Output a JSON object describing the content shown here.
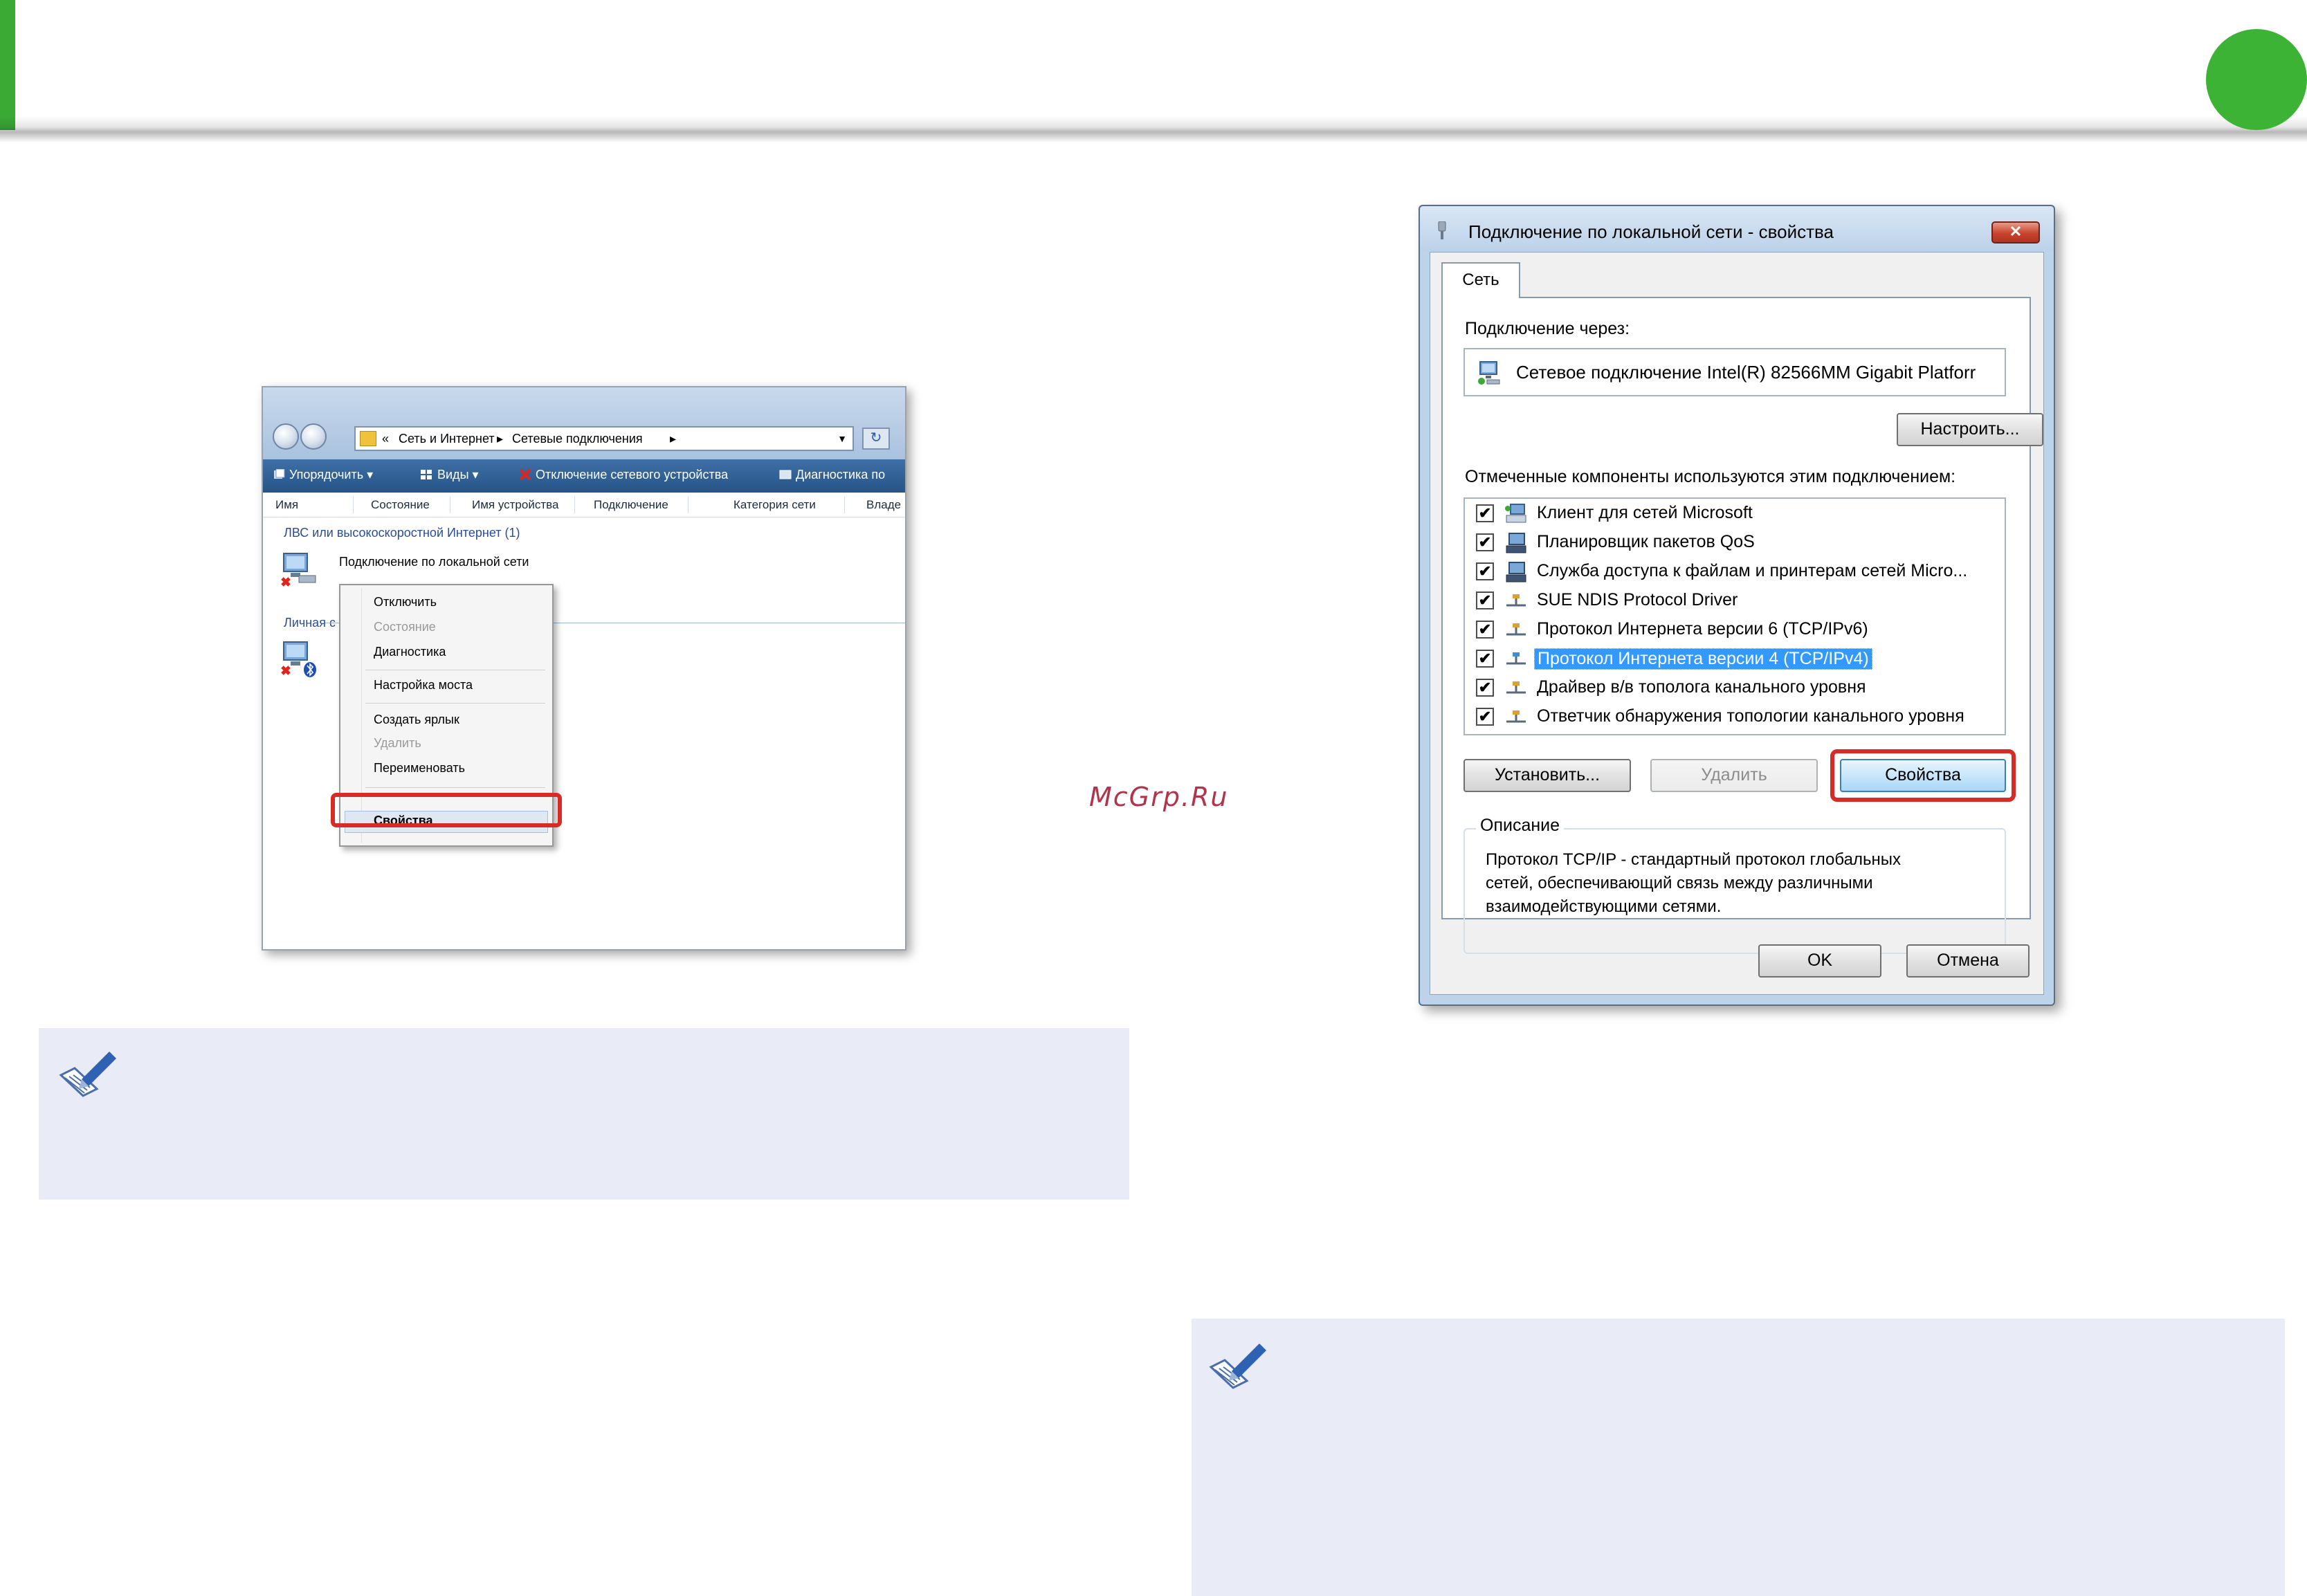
{
  "watermark": "McGrp.Ru",
  "explorer": {
    "breadcrumb": [
      "«",
      "Сеть и Интернет",
      "▸",
      "Сетевые подключения",
      "▸"
    ],
    "toolbar": {
      "organize": "Упорядочить ▾",
      "views": "Виды ▾",
      "disable": "Отключение сетевого устройства",
      "diagnose": "Диагностика по"
    },
    "columns": [
      "Имя",
      "Состояние",
      "Имя устройства",
      "Подключение",
      "Категория сети",
      "Владе"
    ],
    "group_lan": "ЛВС или высокоскоростной Интернет (1)",
    "group_pan": "Личная с",
    "connection_label": "Подключение по локальной сети",
    "context_menu": {
      "items": [
        {
          "label": "Отключить",
          "enabled": true
        },
        {
          "label": "Состояние",
          "enabled": false
        },
        {
          "label": "Диагностика",
          "enabled": true
        },
        {
          "label": "Настройка моста",
          "enabled": true
        },
        {
          "label": "Создать ярлык",
          "enabled": true
        },
        {
          "label": "Удалить",
          "enabled": false
        },
        {
          "label": "Переименовать",
          "enabled": true
        },
        {
          "label": "Свойства",
          "enabled": true,
          "bold": true
        }
      ]
    }
  },
  "dialog": {
    "title": "Подключение по локальной сети - свойства",
    "close_label": "✕",
    "tab": "Сеть",
    "connect_through_label": "Подключение через:",
    "adapter_name": "Сетевое подключение Intel(R) 82566MM Gigabit Platforr",
    "configure_button": "Настроить...",
    "components_label": "Отмеченные компоненты используются этим подключением:",
    "components": [
      {
        "label": "Клиент для сетей Microsoft",
        "checked": true,
        "icon": "network-client-icon",
        "selected": false
      },
      {
        "label": "Планировщик пакетов QoS",
        "checked": true,
        "icon": "network-service-icon",
        "selected": false
      },
      {
        "label": "Служба доступа к файлам и принтерам сетей Micro...",
        "checked": true,
        "icon": "network-service-icon",
        "selected": false
      },
      {
        "label": "SUE NDIS Protocol Driver",
        "checked": true,
        "icon": "network-protocol-icon",
        "selected": false
      },
      {
        "label": "Протокол Интернета версии 6 (TCP/IPv6)",
        "checked": true,
        "icon": "network-protocol-icon",
        "selected": false
      },
      {
        "label": "Протокол Интернета версии 4 (TCP/IPv4)",
        "checked": true,
        "icon": "network-protocol-icon",
        "selected": true
      },
      {
        "label": "Драйвер в/в тополога канального уровня",
        "checked": true,
        "icon": "network-protocol-icon",
        "selected": false
      },
      {
        "label": "Ответчик обнаружения топологии канального уровня",
        "checked": true,
        "icon": "network-protocol-icon",
        "selected": false
      }
    ],
    "install_button": "Установить...",
    "remove_button": "Удалить",
    "properties_button": "Свойства",
    "description_label": "Описание",
    "description_lines": [
      "Протокол TCP/IP - стандартный протокол глобальных",
      "сетей, обеспечивающий связь между различными",
      "взаимодействующими сетями."
    ],
    "ok_button": "OK",
    "cancel_button": "Отмена"
  },
  "colors": {
    "accent_green": "#3aaa35",
    "highlight_red": "#d72b28",
    "note_bg": "#e9ebf7",
    "selection_blue": "#3399ff"
  }
}
